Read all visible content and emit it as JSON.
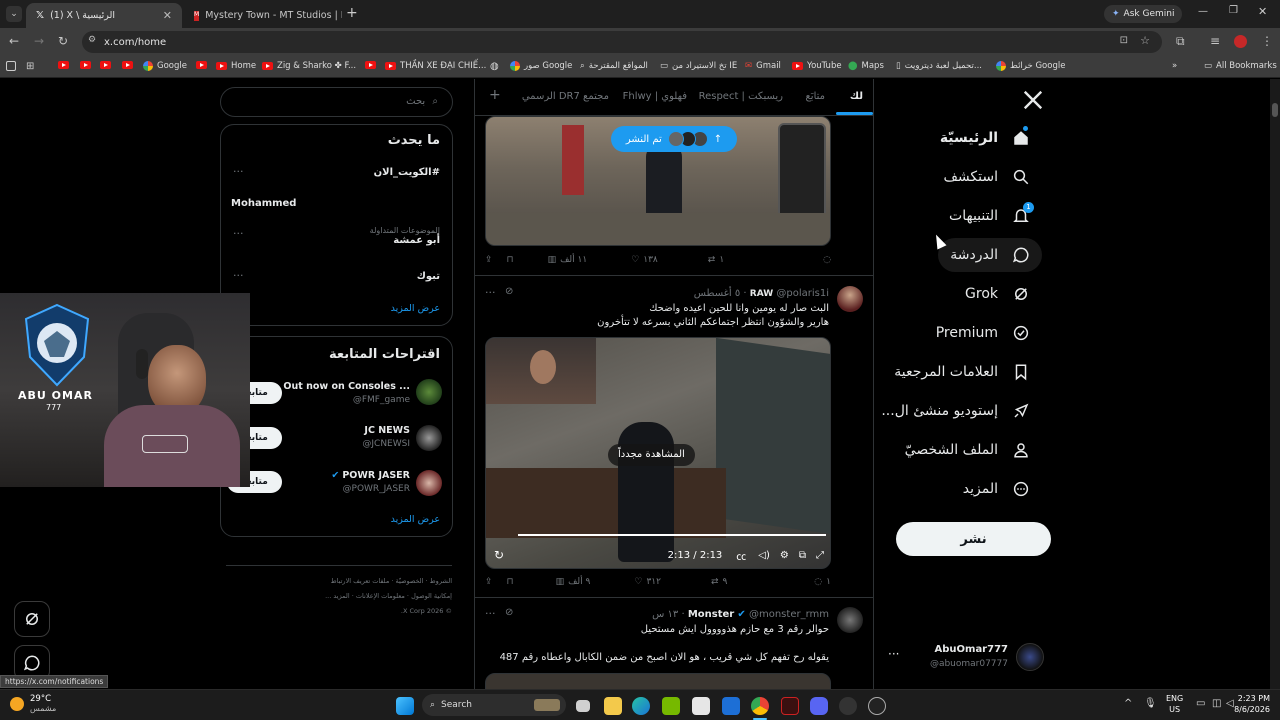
{
  "browser": {
    "tabs": [
      {
        "label": "(1) X \\ الرئيسية",
        "active": true
      },
      {
        "label": "Mystery Town - MT Studios | M",
        "active": false
      }
    ],
    "new_tab": "+",
    "ask_gemini": "Ask Gemini",
    "url": "x.com/home",
    "bookmarks": [
      "Google",
      "Home",
      "Zig & Sharko ✤ F...",
      "THẦN XE ĐẠI CHIẾ...",
      "صور Google",
      "المواقع المقترحة",
      "تخ الاستيراد من IE",
      "Gmail",
      "YouTube",
      "Maps",
      "تحميل لعبة ديترويت...",
      "خرائط Google"
    ],
    "all_bookmarks": "All Bookmarks",
    "status_url": "https://x.com/notifications"
  },
  "nav": {
    "items": [
      {
        "label": "الرئيسيّة",
        "icon": "home-icon",
        "bold": true
      },
      {
        "label": "استكشف",
        "icon": "search-icon"
      },
      {
        "label": "التنبيهات",
        "icon": "bell-icon"
      },
      {
        "label": "الدردشة",
        "icon": "chat-icon"
      },
      {
        "label": "Grok",
        "icon": "grok-icon"
      },
      {
        "label": "Premium",
        "icon": "premium-icon"
      },
      {
        "label": "العلامات المرجعية",
        "icon": "bookmark-icon"
      },
      {
        "label": "إستوديو منشئ ال...",
        "icon": "rocket-icon"
      },
      {
        "label": "الملف الشخصيّ",
        "icon": "profile-icon"
      },
      {
        "label": "المزيد",
        "icon": "more-icon"
      }
    ],
    "post_button": "نشر",
    "account_name": "AbuOmar777",
    "account_handle": "@abuomar07777",
    "notification_badge": "1"
  },
  "feed": {
    "tabs": [
      "لك",
      "متابَع",
      "ريسبكت | Respect",
      "فهلوي | Fhlwy",
      "مجتمع DR7 الرسمي"
    ],
    "posted_pill": "تم النشر",
    "tweet1": {
      "retweets": "١",
      "likes": "١٣٨",
      "views": "١١ ألف"
    },
    "tweet2": {
      "name": "RAW",
      "handle": "@polaris1i",
      "time": "٥ أغسطس",
      "line1": "البث صار له يومين وانا للحين اعيده واضحك",
      "line2": "هارير والشوّون انتظر اجتماعكم الثاني بسرعه لا تتأخرون",
      "replay": "المشاهدة مجدداً",
      "time_display": "2:13 / 2:13",
      "replies": "١",
      "retweets": "٩",
      "likes": "٣١٢",
      "views": "٩ ألف"
    },
    "tweet3": {
      "name": "Monster",
      "handle": "@monster_rmm",
      "time": "١٣ س",
      "line1": "حوالر رقم 3 مع حازم هذوووول ايش مستحيل",
      "line2": "يقوله رح تفهم كل شي قريب ، هو الان اصبح من ضمن الكابال واعطاه رقم 487"
    }
  },
  "sidebar": {
    "search_placeholder": "بحث",
    "whats_happening": "ما يحدث",
    "trends": [
      {
        "context": "",
        "name": "#الكويت_الان"
      },
      {
        "context": "",
        "name": "Mohammed"
      },
      {
        "context": "الموضوعات المتداولة",
        "name": "أبو عمشة"
      },
      {
        "context": "",
        "name": "تبوك"
      }
    ],
    "show_more": "عرض المزيد",
    "who_to_follow": "اقتراحات المتابعة",
    "follow_suggestions": [
      {
        "name": "Out now on Consoles ...",
        "handle": "@FMF_game"
      },
      {
        "name": "JC NEWS",
        "handle": "@JCNEWSI"
      },
      {
        "name": "POWR JASER",
        "handle": "@POWR_JASER"
      }
    ],
    "follow_label": "متابعة",
    "show_more_2": "عرض المزيد",
    "footer": [
      "الشروط",
      "الخصوصيّة",
      "ملفات تعريف الارتباط",
      "إمكانية الوصول",
      "معلومات الإعلانات",
      "المزيد ...",
      "© 2026 X Corp."
    ]
  },
  "overlay": {
    "logo_text": "ABU OMAR",
    "logo_sub": "777"
  },
  "taskbar": {
    "weather_temp": "29°C",
    "weather_desc": "مشمس",
    "search": "Search",
    "lang": "ENG",
    "region": "US",
    "time": "2:23 PM",
    "date": "8/6/2026"
  },
  "colors": {
    "accent": "#1d9bf0",
    "bg": "#000000",
    "border": "#2f3336"
  }
}
